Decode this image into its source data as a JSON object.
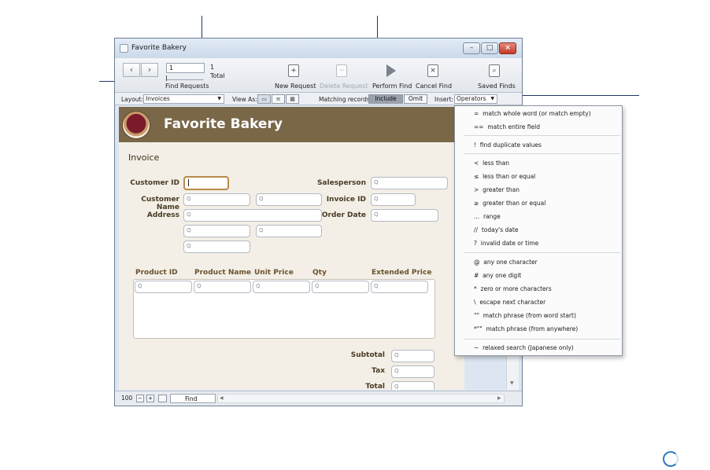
{
  "window": {
    "title": "Favorite Bakery",
    "controls": {
      "minimize": "–",
      "maximize": "□",
      "close": "×"
    }
  },
  "toolbar": {
    "record_value": "1",
    "total_count": "1",
    "total_label": "Total",
    "find_requests_label": "Find Requests",
    "new_request": "New Request",
    "delete_request": "Delete Request",
    "perform_find": "Perform Find",
    "cancel_find": "Cancel Find",
    "saved_finds": "Saved Finds"
  },
  "layoutbar": {
    "layout_label": "Layout:",
    "layout_value": "Invoices",
    "view_as_label": "View As:",
    "matching_label": "Matching records:",
    "include": "Include",
    "omit": "Omit",
    "insert_label": "Insert:",
    "insert_value": "Operators"
  },
  "form": {
    "brand": "Favorite Bakery",
    "section": "Invoice",
    "customer_id": "Customer ID",
    "customer_name": "Customer Name",
    "address": "Address",
    "salesperson": "Salesperson",
    "invoice_id": "Invoice ID",
    "order_date": "Order Date",
    "columns": [
      "Product ID",
      "Product Name",
      "Unit Price",
      "Qty",
      "Extended Price"
    ],
    "subtotal": "Subtotal",
    "tax": "Tax",
    "total": "Total",
    "search_glyph": "Q"
  },
  "statusbar": {
    "zoom": "100",
    "mode": "Find"
  },
  "operators_menu": [
    {
      "sym": "=",
      "text": "match whole word (or match empty)"
    },
    {
      "sym": "==",
      "text": "match entire field"
    },
    {
      "sym": "!",
      "text": "find duplicate values"
    },
    {
      "sym": "<",
      "text": "less than"
    },
    {
      "sym": "≤",
      "text": "less than or equal"
    },
    {
      "sym": ">",
      "text": "greater than"
    },
    {
      "sym": "≥",
      "text": "greater than or equal"
    },
    {
      "sym": "...",
      "text": "range"
    },
    {
      "sym": "//",
      "text": "today's date"
    },
    {
      "sym": "?",
      "text": "invalid date or time"
    },
    {
      "sym": "@",
      "text": "any one character"
    },
    {
      "sym": "#",
      "text": "any one digit"
    },
    {
      "sym": "*",
      "text": "zero or more characters"
    },
    {
      "sym": "\\",
      "text": "escape next character"
    },
    {
      "sym": "\"\"",
      "text": "match phrase (from word start)"
    },
    {
      "sym": "*\"\"",
      "text": "match phrase (from anywhere)"
    },
    {
      "sym": "~",
      "text": "relaxed search (Japanese only)"
    }
  ]
}
